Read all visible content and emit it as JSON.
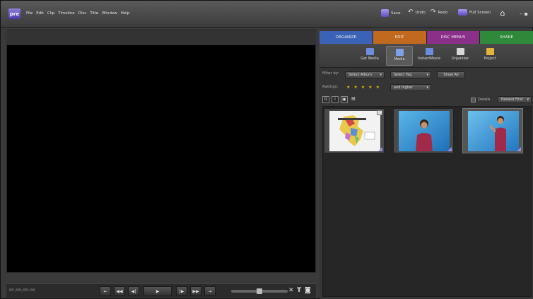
{
  "app": {
    "logo": "pre"
  },
  "menu": [
    "File",
    "Edit",
    "Clip",
    "Timeline",
    "Disc",
    "Title",
    "Window",
    "Help"
  ],
  "toolbar": {
    "save": "Save",
    "undo": "Undo",
    "redo": "Redo",
    "fullscreen": "Full Screen"
  },
  "tabs": [
    {
      "label": "ORGANIZE",
      "color": "#3a63b8"
    },
    {
      "label": "EDIT",
      "color": "#c0691f"
    },
    {
      "label": "DISC MENUS",
      "color": "#8a2f8a"
    },
    {
      "label": "SHARE",
      "color": "#2e8a3a"
    }
  ],
  "subtabs": [
    {
      "label": "Get Media",
      "icon": "film-icon"
    },
    {
      "label": "Media",
      "icon": "media-icon"
    },
    {
      "label": "InstantMovie",
      "icon": "instant-movie-icon"
    },
    {
      "label": "Organizer",
      "icon": "organizer-icon"
    },
    {
      "label": "Project",
      "icon": "folder-icon"
    }
  ],
  "filters": {
    "filter_by": "Filter by:",
    "album": "Select Album",
    "tag": "Select Tag",
    "show_all": "Show All",
    "ratings": "Ratings:",
    "higher": "and higher"
  },
  "view": {
    "details": "Details",
    "sort": "Newest First"
  },
  "transport": {
    "timecode": "00;00;00;00"
  },
  "accent": "#5c4bc0"
}
